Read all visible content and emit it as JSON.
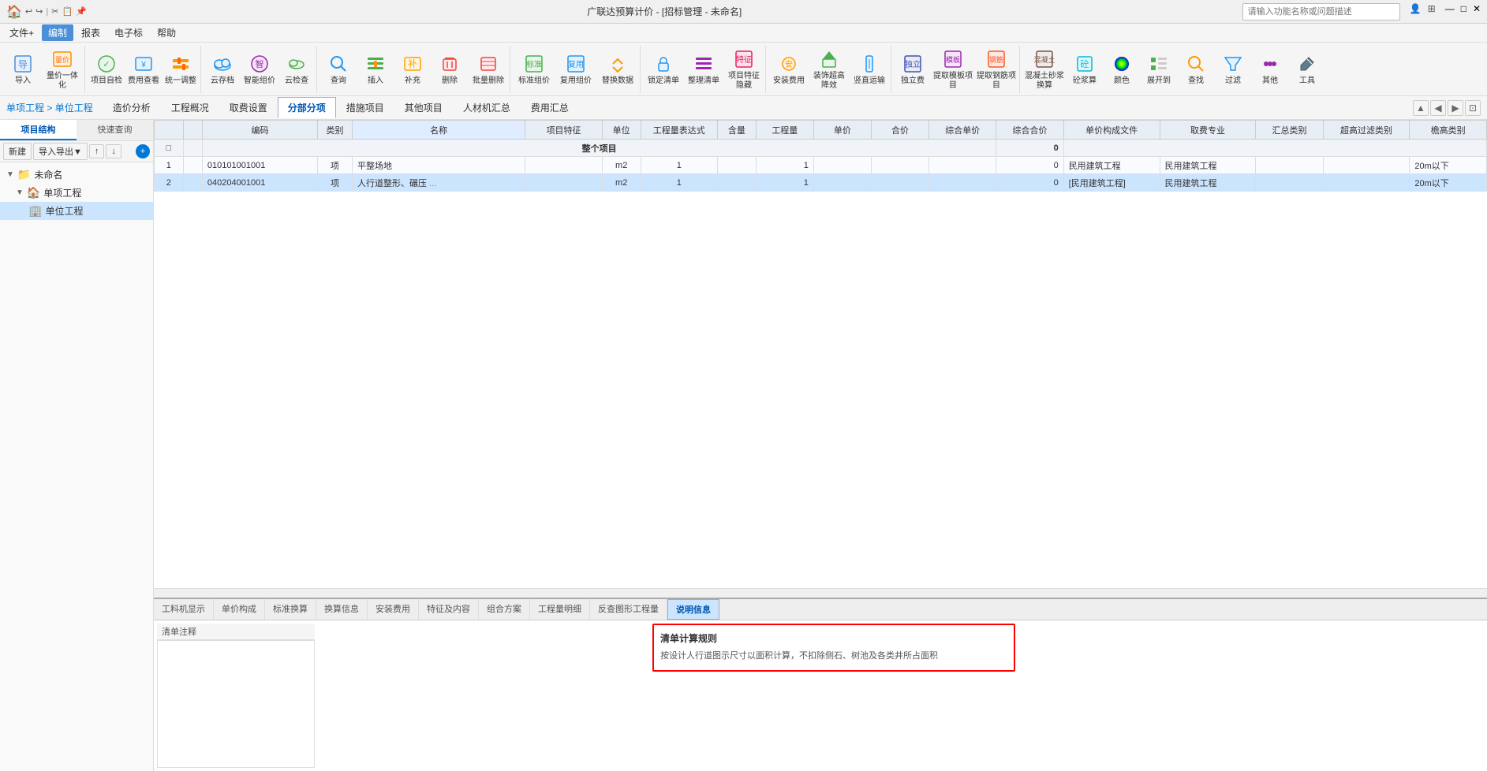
{
  "app": {
    "title": "广联达预算计价 - [招标管理 - 未命名]",
    "logo": "🏠"
  },
  "titlebar": {
    "controls": [
      "—",
      "□",
      "✕"
    ],
    "search_placeholder": "请输入功能名称或问题描述"
  },
  "menubar": {
    "items": [
      "文件+",
      "编制",
      "报表",
      "电子标",
      "帮助"
    ]
  },
  "toolbar": {
    "groups": [
      {
        "buttons": [
          {
            "icon": "📥",
            "label": "导入"
          },
          {
            "icon": "📊",
            "label": "量价一体化"
          }
        ]
      },
      {
        "buttons": [
          {
            "icon": "🔍",
            "label": "项目自检"
          },
          {
            "icon": "💰",
            "label": "费用查看"
          },
          {
            "icon": "⚙️",
            "label": "统一调整"
          }
        ]
      },
      {
        "buttons": [
          {
            "icon": "☁️",
            "label": "云存档"
          },
          {
            "icon": "🧠",
            "label": "智能组价"
          },
          {
            "icon": "🔎",
            "label": "云检查"
          }
        ]
      },
      {
        "buttons": [
          {
            "icon": "🔍",
            "label": "查询"
          },
          {
            "icon": "➕",
            "label": "插入"
          },
          {
            "icon": "📋",
            "label": "补充"
          },
          {
            "icon": "🗑️",
            "label": "删除"
          },
          {
            "icon": "📦",
            "label": "批量删除"
          }
        ]
      },
      {
        "buttons": [
          {
            "icon": "📋",
            "label": "标准组价"
          },
          {
            "icon": "📑",
            "label": "复用组价"
          },
          {
            "icon": "🔄",
            "label": "替换数据"
          }
        ]
      },
      {
        "buttons": [
          {
            "icon": "🔒",
            "label": "锁定清单"
          },
          {
            "icon": "🔧",
            "label": "整理清单"
          },
          {
            "icon": "📄",
            "label": "项目特征隐藏"
          }
        ]
      },
      {
        "buttons": [
          {
            "icon": "💲",
            "label": "安装费用"
          },
          {
            "icon": "🏗️",
            "label": "装饰超高降效"
          },
          {
            "icon": "📐",
            "label": "竖直运输"
          }
        ]
      },
      {
        "buttons": [
          {
            "icon": "📊",
            "label": "独立费"
          },
          {
            "icon": "📋",
            "label": "提取模板项目"
          },
          {
            "icon": "🔗",
            "label": "提取钢筋项目"
          }
        ]
      },
      {
        "buttons": [
          {
            "icon": "🏗️",
            "label": "混凝土砂浆换算"
          },
          {
            "icon": "🔢",
            "label": "砼浆算"
          },
          {
            "icon": "🎨",
            "label": "颜色"
          },
          {
            "icon": "👁️",
            "label": "展开到"
          },
          {
            "icon": "🔍",
            "label": "查找"
          },
          {
            "icon": "🔽",
            "label": "过滤"
          },
          {
            "icon": "📦",
            "label": "其他"
          },
          {
            "icon": "🛠️",
            "label": "工具"
          }
        ]
      }
    ]
  },
  "breadcrumb": {
    "text": "单项工程 > 单位工程",
    "parts": [
      "单项工程",
      "单位工程"
    ]
  },
  "navtabs": {
    "items": [
      "造价分析",
      "工程概况",
      "取费设置",
      "分部分项",
      "措施项目",
      "其他项目",
      "人材机汇总",
      "费用汇总"
    ],
    "active": "分部分项"
  },
  "sidebar": {
    "tabs": [
      "项目结构",
      "快速查询"
    ],
    "active_tab": "项目结构",
    "toolbar": [
      "新建",
      "导入导出▼",
      "↑",
      "↓"
    ],
    "tree": [
      {
        "level": 0,
        "icon": "📁",
        "label": "未命名",
        "expanded": true
      },
      {
        "level": 1,
        "icon": "🏠",
        "label": "单项工程",
        "expanded": true
      },
      {
        "level": 2,
        "icon": "🏢",
        "label": "单位工程",
        "active": true
      }
    ]
  },
  "table": {
    "columns": [
      {
        "key": "idx",
        "label": ""
      },
      {
        "key": "collapse",
        "label": ""
      },
      {
        "key": "code",
        "label": "编码"
      },
      {
        "key": "type",
        "label": "类别"
      },
      {
        "key": "name",
        "label": "名称"
      },
      {
        "key": "feature",
        "label": "项目特征"
      },
      {
        "key": "unit",
        "label": "单位"
      },
      {
        "key": "formula",
        "label": "工程量表达式"
      },
      {
        "key": "qty",
        "label": "含量"
      },
      {
        "key": "amount",
        "label": "工程量"
      },
      {
        "key": "unit_price",
        "label": "单价"
      },
      {
        "key": "total",
        "label": "合价"
      },
      {
        "key": "comp_unit",
        "label": "综合单价"
      },
      {
        "key": "comp_total",
        "label": "综合合价"
      },
      {
        "key": "unit_files",
        "label": "单价构成文件"
      },
      {
        "key": "specialty",
        "label": "取费专业"
      },
      {
        "key": "summary",
        "label": "汇总类别"
      },
      {
        "key": "exceed_filter",
        "label": "超高过滤类别"
      },
      {
        "key": "height_type",
        "label": "檐高类别"
      }
    ],
    "group_row": {
      "label": "整个项目",
      "comp_total": "0"
    },
    "rows": [
      {
        "idx": "1",
        "code": "010101001001",
        "type": "项",
        "name": "平整场地",
        "feature": "",
        "unit": "m2",
        "formula": "1",
        "qty": "",
        "amount": "1",
        "unit_price": "",
        "total": "",
        "comp_unit": "",
        "comp_total": "0",
        "unit_files": "民用建筑工程",
        "specialty": "民用建筑工程",
        "summary": "",
        "exceed_filter": "",
        "height_type": "20m以下",
        "selected": false
      },
      {
        "idx": "2",
        "code": "040204001001",
        "type": "项",
        "name": "人行道整形、碾压",
        "feature": "...",
        "unit": "m2",
        "formula": "1",
        "qty": "",
        "amount": "1",
        "unit_price": "",
        "total": "",
        "comp_unit": "",
        "comp_total": "0",
        "unit_files": "[民用建筑工程]",
        "specialty": "民用建筑工程",
        "summary": "",
        "exceed_filter": "",
        "height_type": "20m以下",
        "selected": true
      }
    ]
  },
  "bottom_panel": {
    "tabs": [
      "工料机显示",
      "单价构成",
      "标准换算",
      "换算信息",
      "安装费用",
      "特征及内容",
      "组合方案",
      "工程量明细",
      "反查图形工程量",
      "说明信息"
    ],
    "active_tab": "说明信息",
    "comment_label": "清单注释",
    "comment_text": "",
    "rule_popup": {
      "title": "清单计算规则",
      "content": "按设计人行道图示尺寸以面积计算，不扣除侧石、树池及各类井所占面积"
    }
  }
}
